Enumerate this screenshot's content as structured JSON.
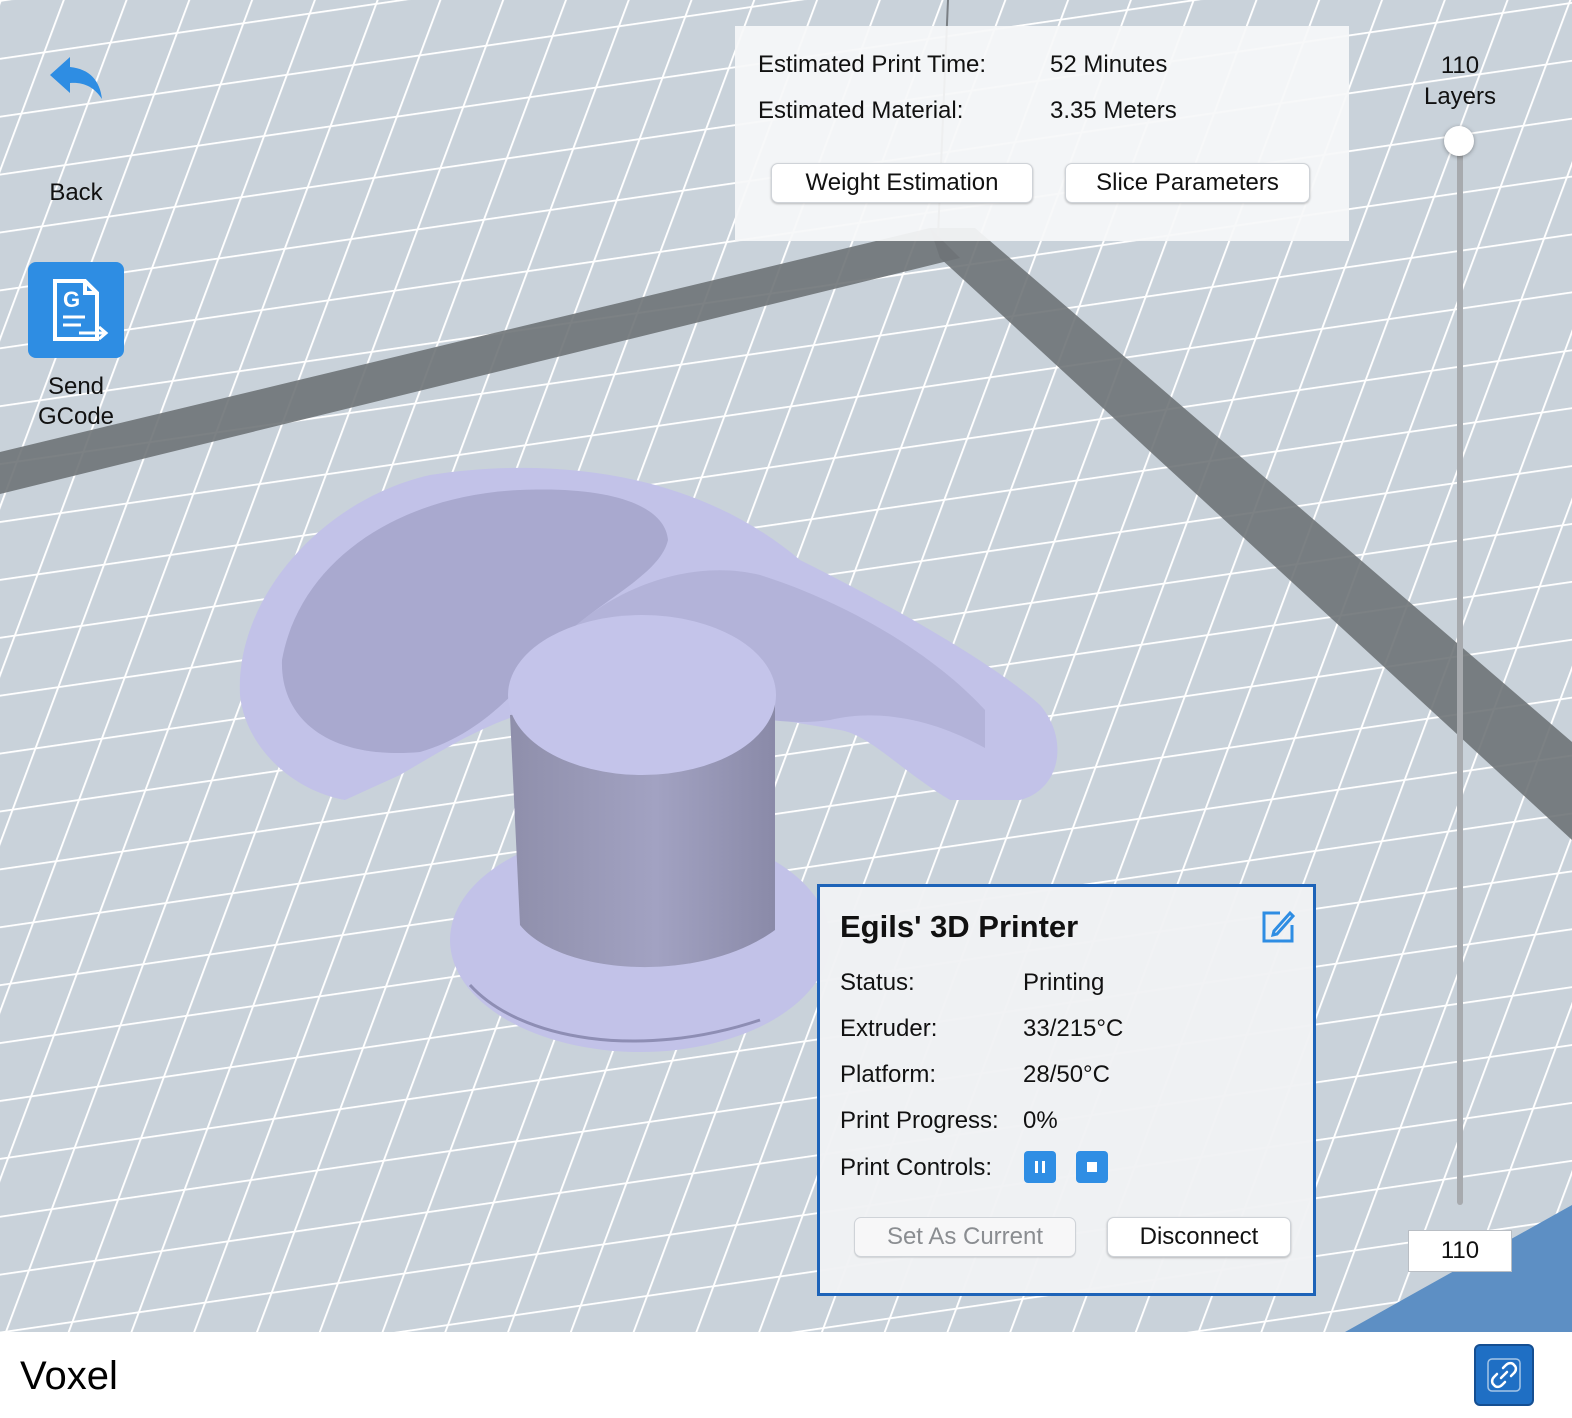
{
  "toolbar": {
    "back_label": "Back",
    "back_icon": "undo-arrow-icon",
    "send_label_line1": "Send",
    "send_label_line2": "GCode",
    "send_icon": "gcode-file-icon"
  },
  "estimates": {
    "print_time_label": "Estimated Print Time:",
    "print_time_value": "52 Minutes",
    "material_label": "Estimated Material:",
    "material_value": "3.35 Meters",
    "weight_button": "Weight Estimation",
    "slice_button": "Slice Parameters"
  },
  "layers": {
    "count": "110",
    "label": "Layers",
    "input_value": "110"
  },
  "printer": {
    "name": "Egils' 3D Printer",
    "status_label": "Status:",
    "status_value": "Printing",
    "extruder_label": "Extruder:",
    "extruder_value": "33/215°C",
    "platform_label": "Platform:",
    "platform_value": "28/50°C",
    "progress_label": "Print Progress:",
    "progress_value": "0%",
    "controls_label": "Print Controls:",
    "set_current_button": "Set As Current",
    "disconnect_button": "Disconnect"
  },
  "footer": {
    "app_name": "Voxel",
    "link_icon": "link-icon"
  },
  "colors": {
    "accent_blue": "#2e8de3",
    "card_border": "#1d63b8",
    "model_fill": "#c2c2e8",
    "grid_background": "#cfd8df"
  }
}
